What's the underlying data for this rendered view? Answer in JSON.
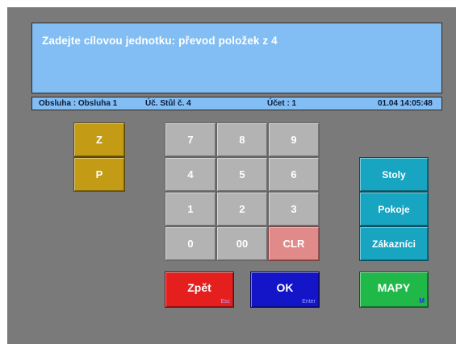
{
  "prompt": {
    "text": "Zadejte cílovou jednotku: převod položek z 4"
  },
  "status": {
    "waiter": "Obsluha : Obsluha 1",
    "table": "Úč. Stůl č. 4",
    "account": "Účet : 1",
    "datetime": "01.04 14:05:48"
  },
  "left_buttons": {
    "z": "Z",
    "p": "P"
  },
  "keypad": {
    "k7": "7",
    "k8": "8",
    "k9": "9",
    "k4": "4",
    "k5": "5",
    "k6": "6",
    "k1": "1",
    "k2": "2",
    "k3": "3",
    "k0": "0",
    "k00": "00",
    "clr": "CLR"
  },
  "right_buttons": {
    "stoly": "Stoly",
    "pokoje": "Pokoje",
    "zakaznici": "Zákazníci"
  },
  "actions": {
    "back": {
      "label": "Zpět",
      "hint": "Esc"
    },
    "ok": {
      "label": "OK",
      "hint": "Enter"
    },
    "maps": {
      "label": "MAPY",
      "hint": "M"
    }
  },
  "colors": {
    "background": "#7a7a7a",
    "panel": "#82bdf3",
    "gold": "#c39b14",
    "keypad": "#b3b3b3",
    "clear": "#e08a8a",
    "teal": "#17a5c2",
    "red": "#e51e1e",
    "blue": "#1414c8",
    "green": "#21b84a"
  }
}
